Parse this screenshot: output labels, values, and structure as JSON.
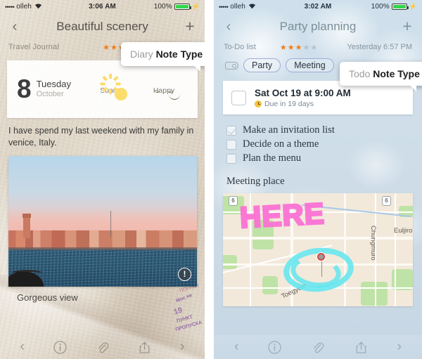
{
  "left": {
    "status": {
      "dots": "•••••",
      "carrier": "olleh",
      "wifi": "▼",
      "time": "3:06 AM",
      "battery_pct": "100%",
      "bolt": "⚡"
    },
    "nav": {
      "back": "‹",
      "title": "Beautiful scenery",
      "add": "+"
    },
    "meta": {
      "journal": "Travel Journal",
      "stars_filled": 4,
      "stars_total": 5
    },
    "date_card": {
      "day_num": "8",
      "weekday": "Tuesday",
      "month": "October"
    },
    "moods": [
      {
        "icon": "sun-icon",
        "label": "Sunny"
      },
      {
        "icon": "smiley-happy-icon",
        "label": "Happy"
      }
    ],
    "note_text": "I have spend my last weekend with my family in venice, Italy.",
    "photo": {
      "badge": "!",
      "caption": "Gorgeous view"
    },
    "stamps": [
      "Мос\nкв",
      "19",
      "ПУНКТ\nПРОПУСКА",
      "P"
    ],
    "popover": {
      "prefix": "Diary",
      "label": "Note Type"
    },
    "toolbar": [
      "‹",
      "info-icon",
      "paperclip-icon",
      "share-icon",
      "›"
    ]
  },
  "right": {
    "status": {
      "dots": "•••••",
      "carrier": "olleh",
      "wifi": "▼",
      "time": "3:02 AM",
      "battery_pct": "100%",
      "bolt": "⚡"
    },
    "nav": {
      "back": "‹",
      "title": "Party planning",
      "add": "+"
    },
    "meta": {
      "list_name": "To-Do list",
      "stars_filled": 3,
      "stars_total": 5,
      "timestamp": "Yesterday 6:57 PM"
    },
    "tags": [
      "Party",
      "Meeting"
    ],
    "task": {
      "title": "Sat Oct 19 at 9:00 AM",
      "due": "Due in 19 days",
      "checked": false
    },
    "checklist": [
      {
        "label": "Make an invitation list",
        "checked": true
      },
      {
        "label": "Decide on a theme",
        "checked": false
      },
      {
        "label": "Plan the menu",
        "checked": false
      }
    ],
    "section_label": "Meeting place",
    "map": {
      "annotation": "HERE",
      "labels": [
        "Euljiro",
        "Chungmuro",
        "Toegyelo"
      ],
      "shields": [
        "6",
        "6"
      ]
    },
    "popover": {
      "prefix": "Todo",
      "label": "Note Type"
    },
    "toolbar": [
      "‹",
      "info-icon",
      "paperclip-icon",
      "share-icon",
      "›"
    ]
  },
  "colors": {
    "star_on": "#f07d1a",
    "star_off": "#b9b2a7",
    "battery_green": "#32d74b",
    "pink_marker": "#fb6fd4",
    "cyan_marker": "#63e6ef",
    "pill_border": "#9fabd8"
  }
}
